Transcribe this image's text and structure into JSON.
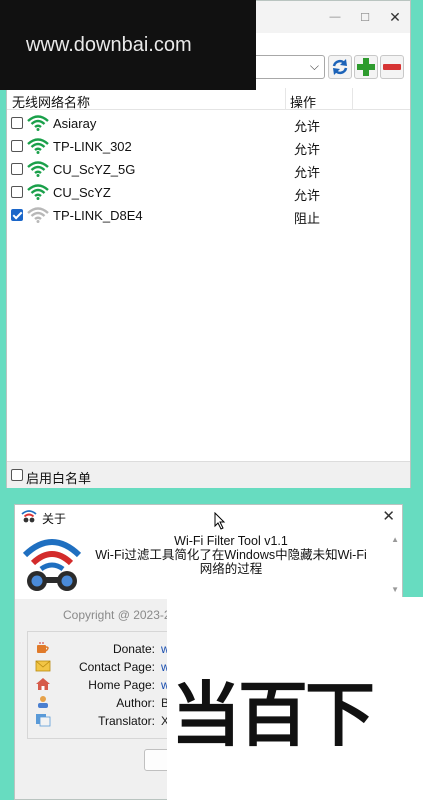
{
  "main_window": {
    "close_glyph": "✕",
    "list": {
      "col_name": "无线网络名称",
      "col_action": "操作",
      "rows": [
        {
          "ssid": "Asiaray",
          "action": "允许",
          "checked": false,
          "signal": "strong"
        },
        {
          "ssid": "TP-LINK_302",
          "action": "允许",
          "checked": false,
          "signal": "strong"
        },
        {
          "ssid": "CU_ScYZ_5G",
          "action": "允许",
          "checked": false,
          "signal": "strong"
        },
        {
          "ssid": "CU_ScYZ",
          "action": "允许",
          "checked": false,
          "signal": "strong"
        },
        {
          "ssid": "TP-LINK_D8E4",
          "action": "阻止",
          "checked": true,
          "signal": "grey"
        }
      ]
    },
    "toolbar": {
      "refresh_icon": "refresh-icon",
      "add_icon": "plus-icon",
      "remove_icon": "minus-icon"
    },
    "footer": {
      "whitelist_label": "启用白名单"
    }
  },
  "watermark": {
    "text": "www.downbai.com",
    "overlay_text": "当百下"
  },
  "about_window": {
    "title": "关于",
    "close_glyph": "✕",
    "app_name": "Wi-Fi Filter Tool v1.1",
    "description": "Wi-Fi过滤工具简化了在Windows中隐藏未知Wi-Fi网络的过程",
    "copyright": "Copyright @ 2023-2",
    "info": [
      {
        "label": "Donate:",
        "value": "w",
        "icon": "coffee-icon"
      },
      {
        "label": "Contact Page:",
        "value": "w",
        "icon": "envelope-icon"
      },
      {
        "label": "Home Page:",
        "value": "w",
        "icon": "home-icon"
      },
      {
        "label": "Author:",
        "value": "B",
        "icon": "author-icon"
      },
      {
        "label": "Translator:",
        "value": "X",
        "icon": "translator-icon"
      }
    ]
  },
  "colors": {
    "background": "#67dcc0",
    "wifi_green": "#1aa04a",
    "wifi_grey": "#b8b8b8",
    "checkbox_blue": "#1a66c9",
    "link_blue": "#1a4fb0"
  }
}
